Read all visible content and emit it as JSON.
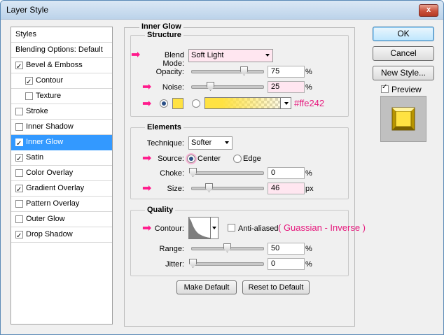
{
  "window": {
    "title": "Layer Style",
    "close_glyph": "x"
  },
  "styles_list": {
    "header": "Styles",
    "blending_options": "Blending Options: Default",
    "items": [
      {
        "label": "Bevel & Emboss",
        "checked": true
      },
      {
        "label": "Contour",
        "checked": true,
        "indent": true
      },
      {
        "label": "Texture",
        "checked": false,
        "indent": true
      },
      {
        "label": "Stroke",
        "checked": false
      },
      {
        "label": "Inner Shadow",
        "checked": false
      },
      {
        "label": "Inner Glow",
        "checked": true,
        "selected": true
      },
      {
        "label": "Satin",
        "checked": true
      },
      {
        "label": "Color Overlay",
        "checked": false
      },
      {
        "label": "Gradient Overlay",
        "checked": true
      },
      {
        "label": "Pattern Overlay",
        "checked": false
      },
      {
        "label": "Outer Glow",
        "checked": false
      },
      {
        "label": "Drop Shadow",
        "checked": true
      }
    ]
  },
  "panel_title": "Inner Glow",
  "structure": {
    "legend": "Structure",
    "blend_mode_label": "Blend Mode:",
    "blend_mode_value": "Soft Light",
    "opacity_label": "Opacity:",
    "opacity_value": "75",
    "noise_label": "Noise:",
    "noise_value": "25",
    "percent": "%",
    "color_hex_annotation": "#ffe242",
    "glow_color": "#ffe242"
  },
  "elements": {
    "legend": "Elements",
    "technique_label": "Technique:",
    "technique_value": "Softer",
    "source_label": "Source:",
    "source_center": "Center",
    "source_edge": "Edge",
    "choke_label": "Choke:",
    "choke_value": "0",
    "size_label": "Size:",
    "size_value": "46",
    "percent": "%",
    "px": "px"
  },
  "quality": {
    "legend": "Quality",
    "contour_label": "Contour:",
    "anti_aliased_label": "Anti-aliased",
    "contour_annotation": "( Guassian - Inverse )",
    "range_label": "Range:",
    "range_value": "50",
    "jitter_label": "Jitter:",
    "jitter_value": "0",
    "percent": "%"
  },
  "buttons": {
    "make_default": "Make Default",
    "reset_to_default": "Reset to Default",
    "ok": "OK",
    "cancel": "Cancel",
    "new_style": "New Style...",
    "preview_label": "Preview"
  },
  "colors": {
    "annotation": "#e6197d",
    "selection": "#3399ff",
    "glow": "#ffe242"
  }
}
